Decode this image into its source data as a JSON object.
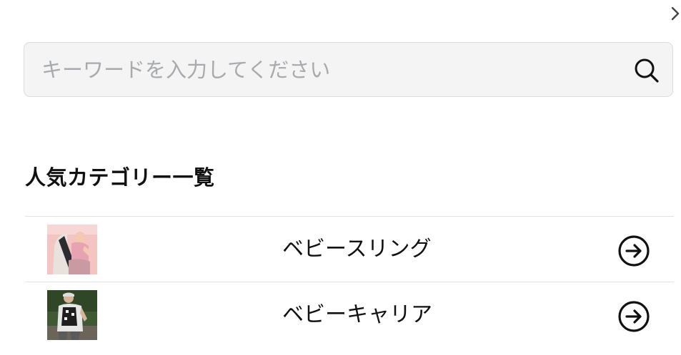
{
  "search": {
    "placeholder": "キーワードを入力してください",
    "value": ""
  },
  "icons": {
    "close": "chevron-right-icon",
    "search": "search-icon",
    "arrow": "arrow-circle-right-icon"
  },
  "popular": {
    "title": "人気カテゴリー一覧",
    "items": [
      {
        "label": "ベビースリング",
        "thumb": "baby-sling-photo"
      },
      {
        "label": "ベビーキャリア",
        "thumb": "baby-carrier-photo"
      }
    ]
  },
  "colors": {
    "search_bg": "#f4f4f4",
    "search_border": "#dcdcdc",
    "placeholder": "#a8aaad",
    "divider": "#e2e2e2",
    "text": "#111111"
  }
}
